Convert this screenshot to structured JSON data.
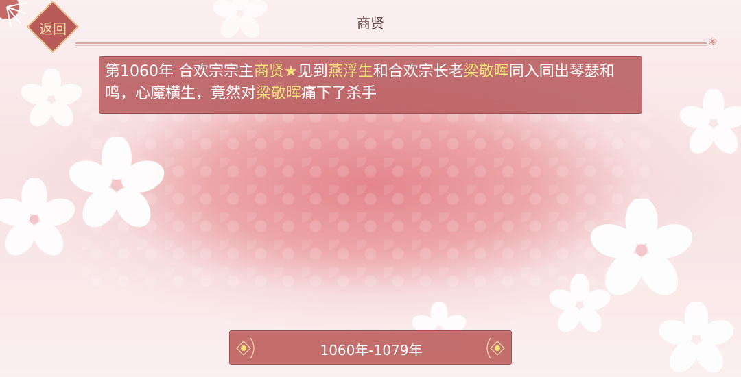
{
  "header": {
    "title": "商贤",
    "back_label": "返回"
  },
  "event": {
    "parts": [
      {
        "text": "第1060年 合欢宗宗主",
        "highlight": false
      },
      {
        "text": "商贤★",
        "highlight": true
      },
      {
        "text": "见到",
        "highlight": false
      },
      {
        "text": "燕浮生",
        "highlight": true
      },
      {
        "text": "和合欢宗长老",
        "highlight": false
      },
      {
        "text": "梁敬晖",
        "highlight": true
      },
      {
        "text": "同入同出琴瑟和鸣，心魔横生，竟然对",
        "highlight": false
      },
      {
        "text": "梁敬晖",
        "highlight": true
      },
      {
        "text": "痛下了杀手",
        "highlight": false
      }
    ]
  },
  "timeline": {
    "range_label": "1060年-1079年"
  },
  "colors": {
    "highlight": "#f6e27a",
    "panel": "#b85c5e",
    "back_button": "#b85a58"
  },
  "icons": [
    "back-button-diamond",
    "scroll-end-ornament",
    "diamond-ornament",
    "flower"
  ]
}
